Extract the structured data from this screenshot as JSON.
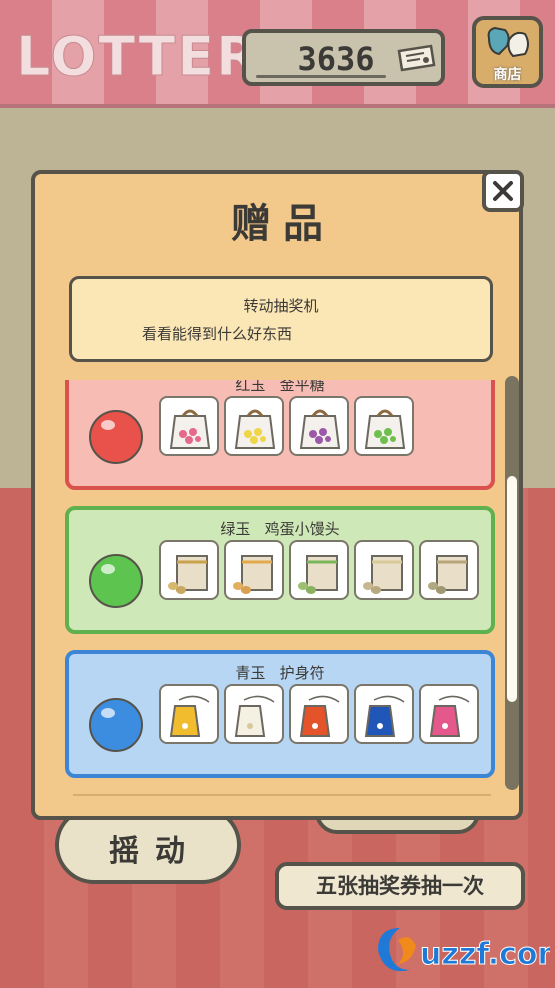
{
  "header": {
    "title": "LOTTERY",
    "ticket_count": "3636",
    "shop_label": "商店"
  },
  "modal": {
    "title": "赠品",
    "info_title": "转动抽奖机",
    "info_desc": "看看能得到什么好东西",
    "prizes": [
      {
        "name": "红玉   金平糖",
        "gem_color": "#e8524a",
        "card_bg": "#f7bcb4",
        "card_border": "#d9524e",
        "items": [
          "pink-candy-bag-icon",
          "yellow-candy-bag-icon",
          "purple-candy-bag-icon",
          "green-candy-bag-icon"
        ]
      },
      {
        "name": "绿玉   鸡蛋小馒头",
        "gem_color": "#5dc54f",
        "card_bg": "#cfe8b8",
        "card_border": "#5fb04e",
        "items": [
          "bun-bag-icon",
          "bun-bag-icon",
          "bun-bag-icon",
          "bun-bag-icon",
          "bun-bag-icon"
        ]
      },
      {
        "name": "青玉   护身符",
        "gem_color": "#3c8de0",
        "card_bg": "#b7d6f3",
        "card_border": "#3d86d6",
        "items": [
          "yellow-amulet-icon",
          "white-amulet-icon",
          "red-amulet-icon",
          "blue-amulet-icon",
          "pink-amulet-icon"
        ]
      }
    ]
  },
  "footer": {
    "shake_label": "摇动",
    "rule_label": "五张抽奖券抽一次",
    "watermark": "uzzf.com"
  },
  "colors": {
    "outline": "#56534a",
    "modal_bg": "#f2c98a",
    "awning_pink": "#e4a1a8",
    "counter_red": "#c8665f"
  }
}
